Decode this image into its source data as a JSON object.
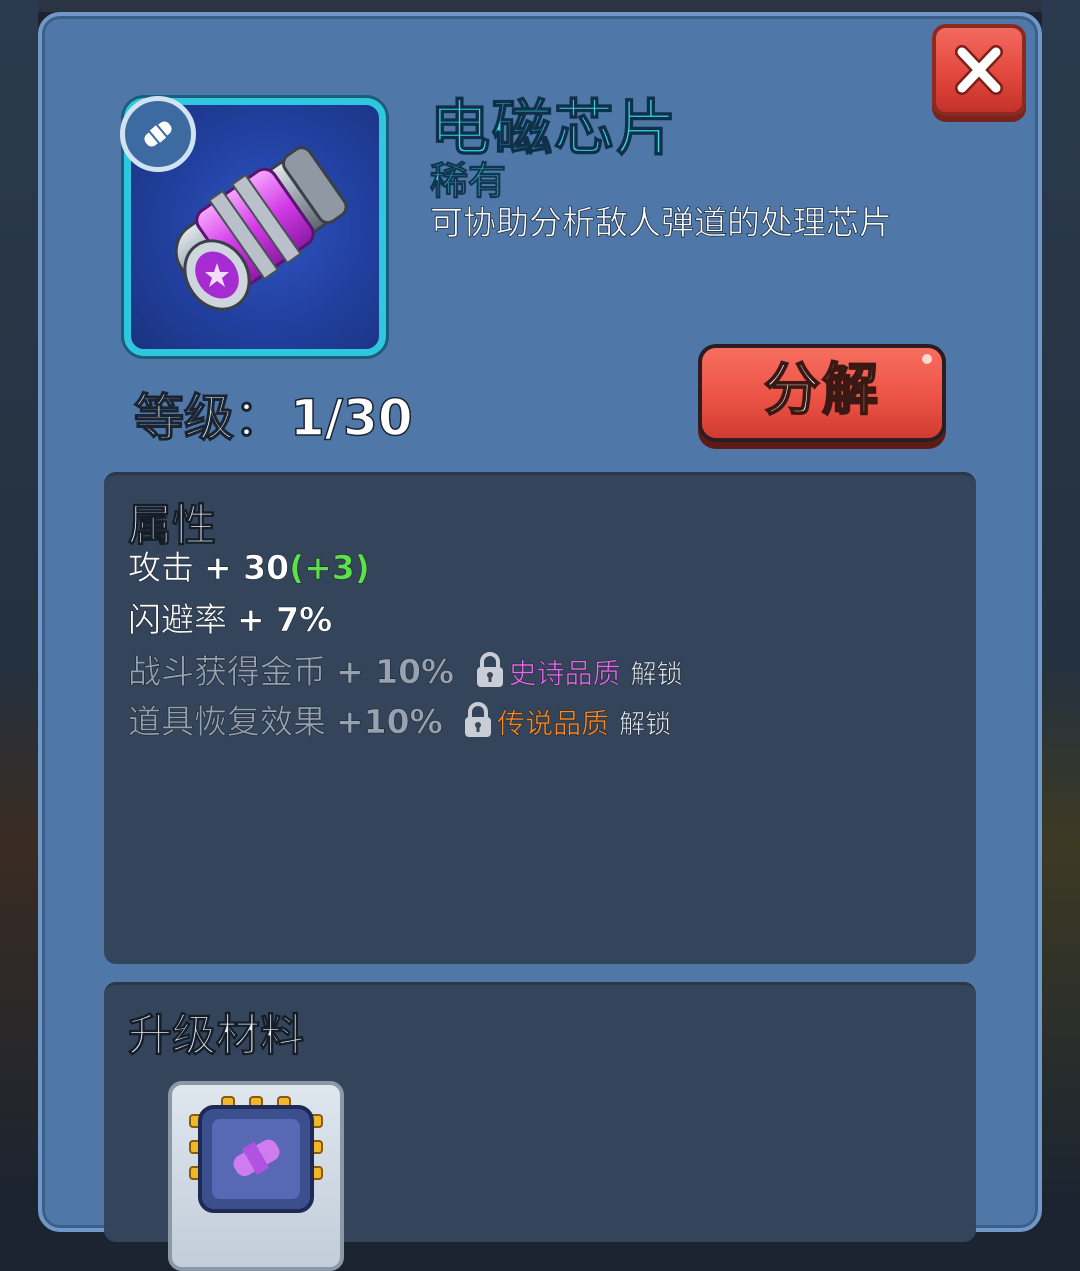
{
  "item": {
    "name": "电磁芯片",
    "rarity": "稀有",
    "description": "可协助分析敌人弹道的处理芯片",
    "icon": "magnetic-capsule-icon",
    "type_icon": "capsule-badge-icon"
  },
  "level": {
    "label": "等级：",
    "value": "1/30"
  },
  "buttons": {
    "decompose": "分解",
    "close_icon": "close-icon"
  },
  "attributes": {
    "title": "属性",
    "items": [
      {
        "name": "攻击",
        "value": "+ 30",
        "bonus": "(+3)"
      },
      {
        "name": "闪避率",
        "value": "+ 7%"
      },
      {
        "name": "战斗获得金币",
        "value": "+ 10%",
        "unlock_quality": "史诗品质",
        "unlock_text": "解锁"
      },
      {
        "name": "道具恢复效果",
        "value": "+10%",
        "unlock_quality": "传说品质",
        "unlock_text": "解锁"
      }
    ]
  },
  "materials": {
    "title": "升级材料",
    "items": [
      {
        "icon": "chip-material-icon"
      }
    ]
  },
  "colors": {
    "panel": "#4f78a8",
    "name": "#34d4e8",
    "bonus": "#5ee04a",
    "epic": "#e36ae8",
    "legendary": "#ff8a1c",
    "button": "#ec5346"
  }
}
